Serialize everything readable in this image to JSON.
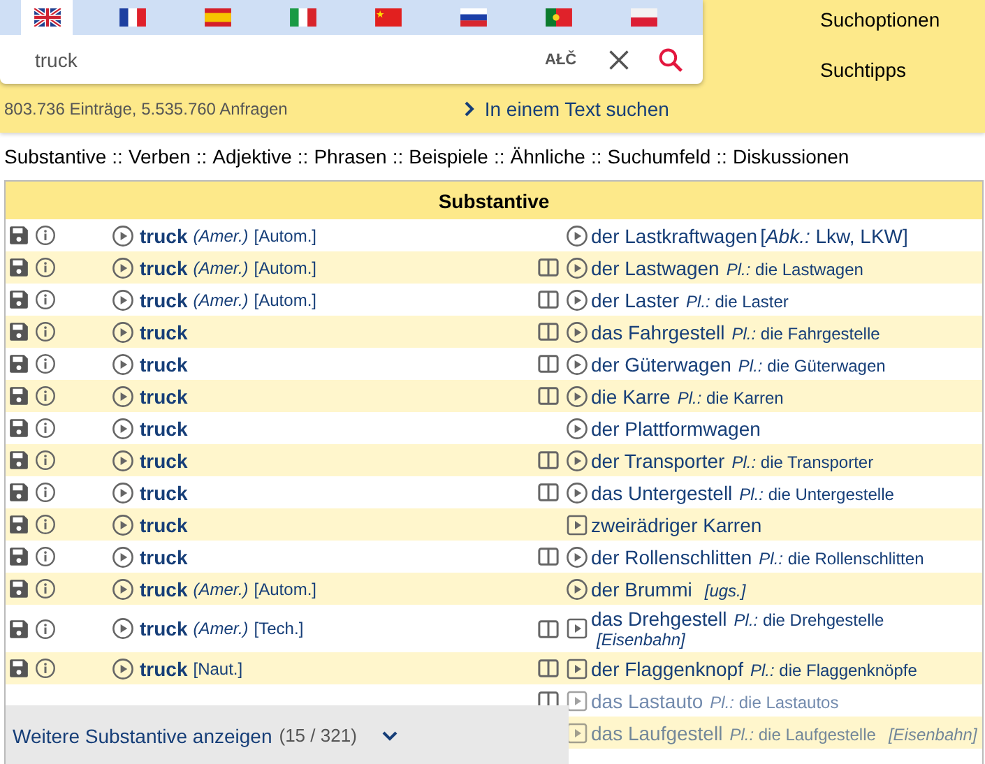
{
  "languages": [
    {
      "kind": "gb",
      "selected": true
    },
    {
      "kind": "fr",
      "selected": false
    },
    {
      "kind": "es",
      "selected": false
    },
    {
      "kind": "it",
      "selected": false
    },
    {
      "kind": "cn",
      "selected": false
    },
    {
      "kind": "ru",
      "selected": false
    },
    {
      "kind": "pt",
      "selected": false
    },
    {
      "kind": "pl",
      "selected": false
    }
  ],
  "search": {
    "value": "truck",
    "special_chars": "AŁČ"
  },
  "side_links": [
    "Suchoptionen",
    "Suchtipps"
  ],
  "stats": "803.736 Einträge, 5.535.760 Anfragen",
  "text_search_link": "In einem Text suchen",
  "categories": [
    "Substantive",
    "Verben",
    "Adjektive",
    "Phrasen",
    "Beispiele",
    "Ähnliche",
    "Suchumfeld",
    "Diskussionen"
  ],
  "category_separator": "::",
  "table": {
    "title": "Substantive",
    "rows": [
      {
        "kind": "circle",
        "left": {
          "term": "truck",
          "region": "(Amer.)",
          "tag": "[Autom.]"
        },
        "table_icon": false,
        "right": {
          "word": "der Lastkraftwagen",
          "extra": "[*Abk.:* Lkw, LKW]"
        }
      },
      {
        "kind": "circle",
        "left": {
          "term": "truck",
          "region": "(Amer.)",
          "tag": "[Autom.]"
        },
        "table_icon": true,
        "right": {
          "word": "der Lastwagen",
          "plural": "*Pl.:* die Lastwagen"
        }
      },
      {
        "kind": "circle",
        "left": {
          "term": "truck",
          "region": "(Amer.)",
          "tag": "[Autom.]"
        },
        "table_icon": true,
        "right": {
          "word": "der Laster",
          "plural": "*Pl.:* die Laster"
        }
      },
      {
        "kind": "circle",
        "left": {
          "term": "truck"
        },
        "table_icon": true,
        "right": {
          "word": "das Fahrgestell",
          "plural": "*Pl.:* die Fahrgestelle"
        }
      },
      {
        "kind": "circle",
        "left": {
          "term": "truck"
        },
        "table_icon": true,
        "right": {
          "word": "der Güterwagen",
          "plural": "*Pl.:* die Güterwagen"
        }
      },
      {
        "kind": "circle",
        "left": {
          "term": "truck"
        },
        "table_icon": true,
        "right": {
          "word": "die Karre",
          "plural": "*Pl.:* die Karren"
        }
      },
      {
        "kind": "circle",
        "left": {
          "term": "truck"
        },
        "table_icon": false,
        "right": {
          "word": "der Plattformwagen"
        }
      },
      {
        "kind": "circle",
        "left": {
          "term": "truck"
        },
        "table_icon": true,
        "right": {
          "word": "der Transporter",
          "plural": "*Pl.:* die Transporter"
        }
      },
      {
        "kind": "circle",
        "left": {
          "term": "truck"
        },
        "table_icon": true,
        "right": {
          "word": "das Untergestell",
          "plural": "*Pl.:* die Untergestelle"
        }
      },
      {
        "kind": "square",
        "left": {
          "term": "truck"
        },
        "table_icon": false,
        "right": {
          "word": "zweirädriger Karren"
        }
      },
      {
        "kind": "circle",
        "left": {
          "term": "truck"
        },
        "table_icon": true,
        "right": {
          "word": "der Rollenschlitten",
          "plural": "*Pl.:* die Rollenschlitten"
        }
      },
      {
        "kind": "circle",
        "left": {
          "term": "truck",
          "region": "(Amer.)",
          "tag": "[Autom.]"
        },
        "table_icon": false,
        "right": {
          "word": "der Brummi",
          "note": "[ugs.]"
        }
      },
      {
        "kind": "square",
        "left": {
          "term": "truck",
          "region": "(Amer.)",
          "tag": "[Tech.]"
        },
        "table_icon": true,
        "right": {
          "word": "das Drehgestell",
          "plural": "*Pl.:* die Drehgestelle",
          "note": "[Eisenbahn]"
        }
      },
      {
        "kind": "square",
        "left": {
          "term": "truck",
          "tag": "[Naut.]"
        },
        "table_icon": true,
        "right": {
          "word": "der Flaggenknopf",
          "plural": "*Pl.:* die Flaggenknöpfe"
        }
      },
      {
        "kind": "square",
        "table_icon": true,
        "faded": true,
        "right": {
          "word": "das Lastauto",
          "plural": "*Pl.:* die Lastautos"
        }
      },
      {
        "kind": "square",
        "table_icon": false,
        "faded": true,
        "right": {
          "word": "das Laufgestell",
          "plural": "*Pl.:* die Laufgestelle",
          "note": "[Eisenbahn]"
        }
      }
    ],
    "more": {
      "label": "Weitere Substantive anzeigen",
      "count": "(15 / 321)"
    }
  }
}
